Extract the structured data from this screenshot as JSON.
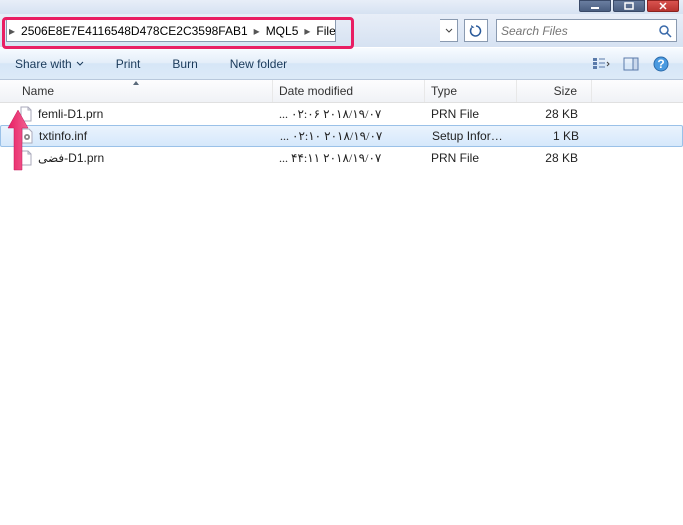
{
  "breadcrumb": {
    "segments": [
      "2506E8E7E4116548D478CE2C3598FAB1",
      "MQL5",
      "Files"
    ]
  },
  "search": {
    "placeholder": "Search Files"
  },
  "toolbar": {
    "share": "Share with",
    "print": "Print",
    "burn": "Burn",
    "newfolder": "New folder"
  },
  "columns": {
    "name": "Name",
    "date": "Date modified",
    "type": "Type",
    "size": "Size"
  },
  "files": [
    {
      "name": "femli-D1.prn",
      "date": "٢٠١٨/١٩/٠٧ ٠٢:٠۶ ...",
      "type": "PRN File",
      "size": "28 KB",
      "iconKind": "blank",
      "selected": false
    },
    {
      "name": "txtinfo.inf",
      "date": "٢٠١٨/١٩/٠٧ ٠٢:١٠ ...",
      "type": "Setup Information",
      "size": "1 KB",
      "iconKind": "gear",
      "selected": true
    },
    {
      "name": "فضى-D1.prn",
      "date": "٢٠١٨/١٩/٠٧ ١١:۴۴ ...",
      "type": "PRN File",
      "size": "28 KB",
      "iconKind": "blank",
      "selected": false
    }
  ]
}
